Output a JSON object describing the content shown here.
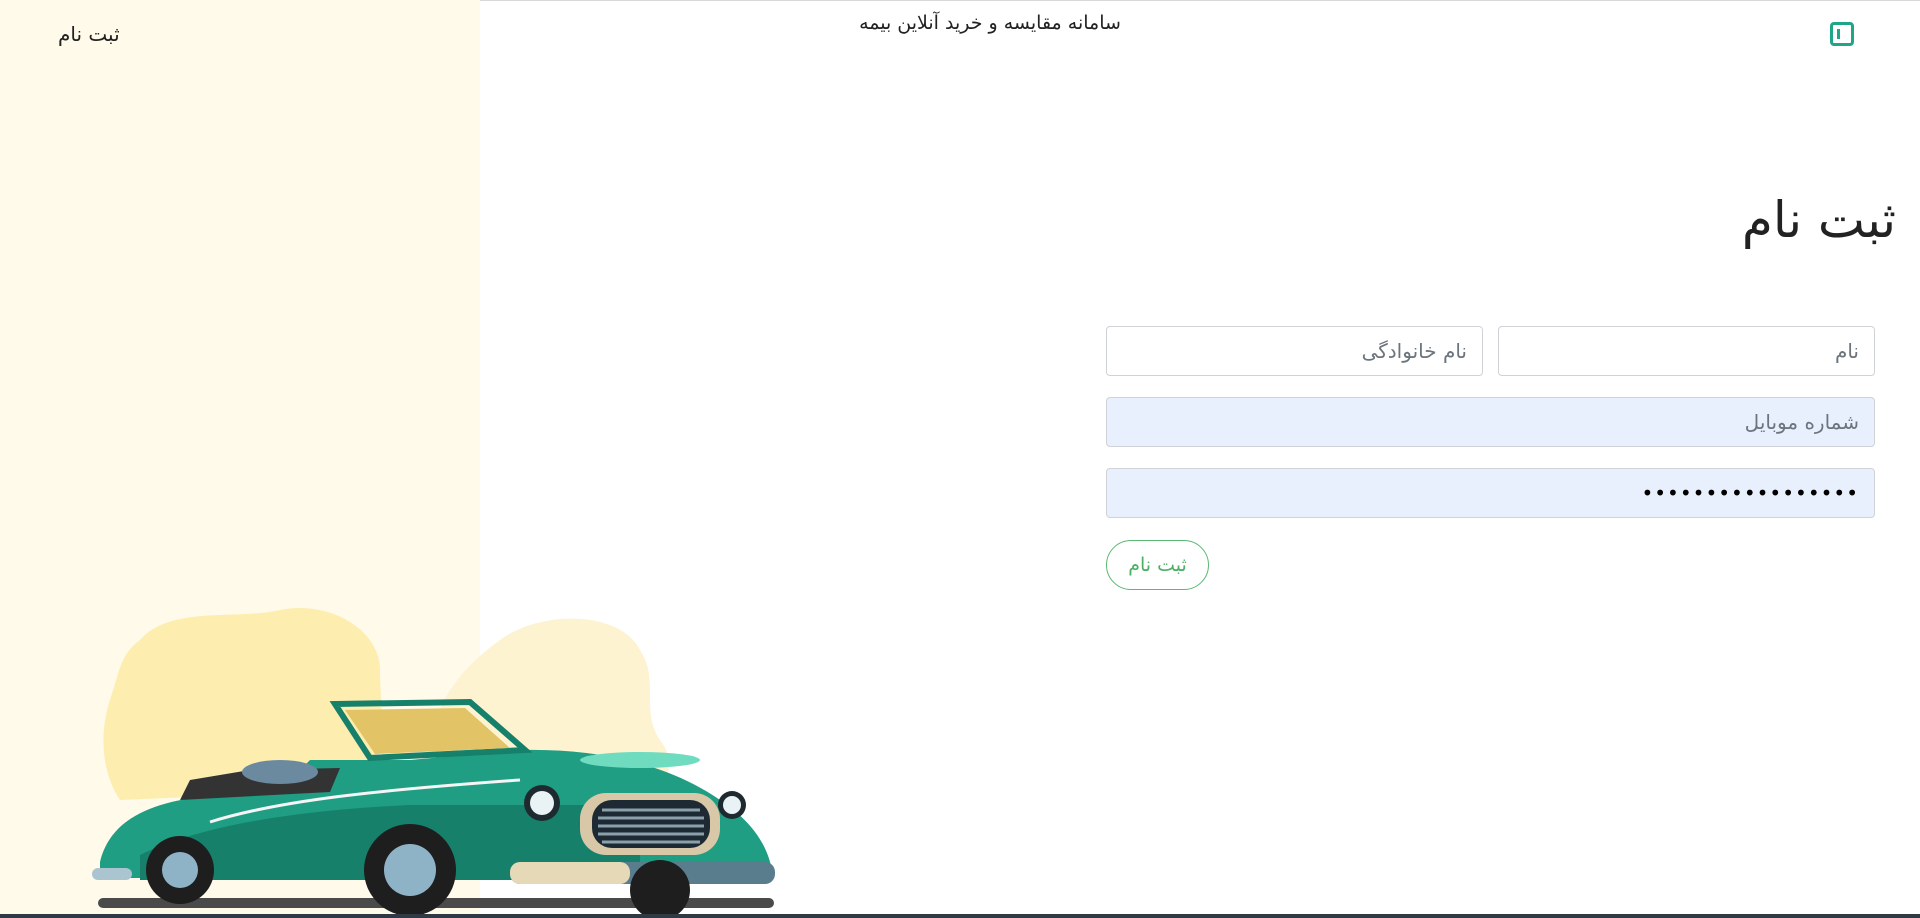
{
  "header": {
    "title": "سامانه مقایسه و خرید آنلاین بیمه",
    "register_link": "ثبت نام",
    "logo_icon": "sidebar-toggle-icon"
  },
  "form": {
    "title": "ثبت نام",
    "first_name_placeholder": "نام",
    "last_name_placeholder": "نام خانوادگی",
    "mobile_placeholder": "شماره موبایل",
    "password_value": "•••••••••••••••••",
    "submit_label": "ثبت نام"
  },
  "illustration": {
    "subject": "green-convertible-car"
  },
  "colors": {
    "accent": "#1ea58a",
    "left_panel_bg": "#fffaea",
    "button_border": "#5cb874",
    "autofill_bg": "#e8f0fe"
  }
}
